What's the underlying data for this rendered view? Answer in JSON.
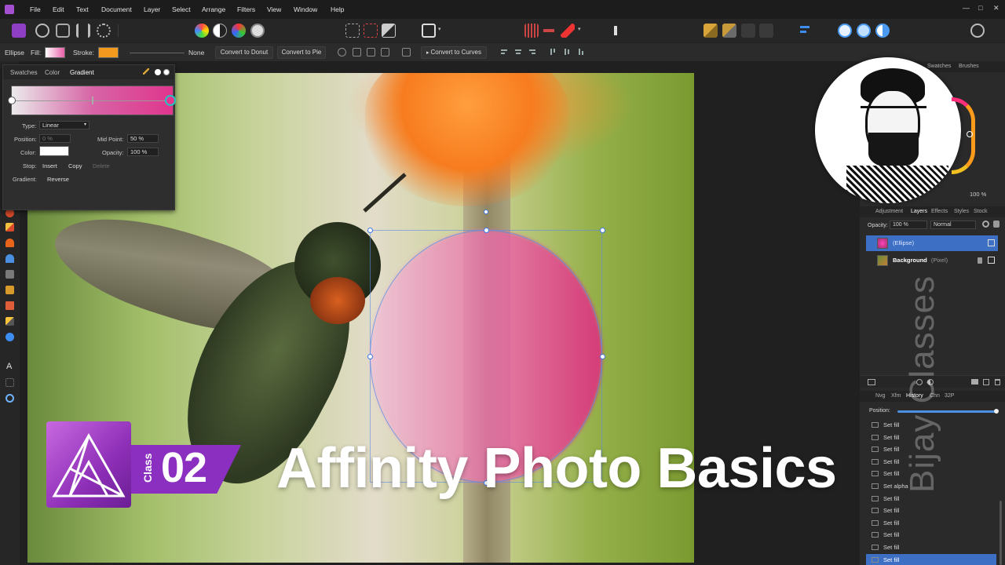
{
  "menu": {
    "items": [
      "File",
      "Edit",
      "Text",
      "Document",
      "Layer",
      "Select",
      "Arrange",
      "Filters",
      "View",
      "Window",
      "Help"
    ],
    "window_controls": [
      "—",
      "□",
      "✕"
    ]
  },
  "context": {
    "tool_name": "Ellipse",
    "fill_label": "Fill:",
    "stroke_label": "Stroke:",
    "stroke_value": "None",
    "convert_donut": "Convert to Donut",
    "convert_pie": "Convert to Pie",
    "convert_curves": "Convert to Curves",
    "colors": {
      "fill": "#e95fa8",
      "stroke": "#f39a1e"
    }
  },
  "gradient_panel": {
    "tabs": [
      "Swatches",
      "Color",
      "Gradient"
    ],
    "active_tab": "Gradient",
    "type_label": "Type:",
    "type_value": "Linear",
    "position_label": "Position:",
    "position_value": "0 %",
    "midpoint_label": "Mid Point:",
    "midpoint_value": "50 %",
    "color_label": "Color:",
    "opacity_label": "Opacity:",
    "opacity_value": "100 %",
    "stop_label": "Stop:",
    "insert": "Insert",
    "copy": "Copy",
    "delete": "Delete",
    "gradient_label": "Gradient:",
    "reverse": "Reverse",
    "colors": {
      "start": "#ffffff",
      "end": "#e0358c"
    }
  },
  "right_panel": {
    "top_tabs": [
      "Swatches",
      "Brushes"
    ],
    "zoom_value": "100 %",
    "layer_tabs": [
      "Adjustment",
      "Layers",
      "Effects",
      "Styles",
      "Stock"
    ],
    "active_layer_tab": "Layers",
    "opacity_label": "Opacity:",
    "opacity_value": "100 %",
    "blend_mode": "Normal",
    "layers": [
      {
        "name": "(Ellipse)",
        "selected": true
      },
      {
        "name": "Background",
        "type": "(Pixel)",
        "selected": false
      }
    ],
    "history_tabs": [
      "Nvg",
      "Xfm",
      "History",
      "Chn",
      "32P"
    ],
    "active_history_tab": "History",
    "position_label": "Position:",
    "history_items": [
      "Set fill",
      "Set fill",
      "Set fill",
      "Set fill",
      "Set fill",
      "Set alpha",
      "Set fill",
      "Set fill",
      "Set fill",
      "Set fill",
      "Set fill",
      "Set fill"
    ]
  },
  "overlay": {
    "class_word": "Class",
    "class_number": "02",
    "title": "Affinity Photo Basics",
    "watermark": "Bijay Classes"
  }
}
